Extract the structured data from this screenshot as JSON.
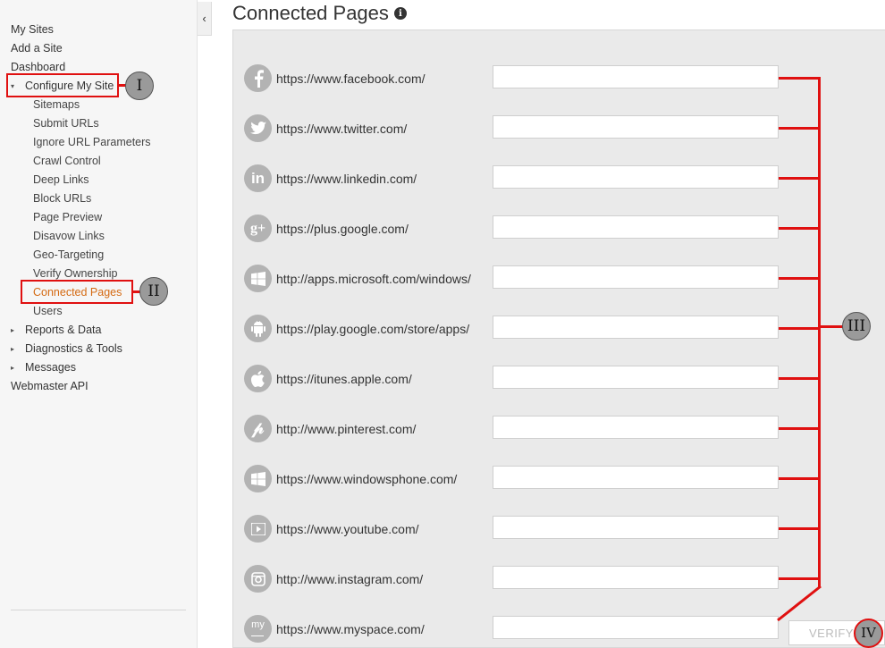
{
  "sidebar": {
    "items": [
      {
        "label": "My Sites"
      },
      {
        "label": "Add a Site"
      },
      {
        "label": "Dashboard"
      },
      {
        "label": "Configure My Site"
      },
      {
        "label": "Sitemaps"
      },
      {
        "label": "Submit URLs"
      },
      {
        "label": "Ignore URL Parameters"
      },
      {
        "label": "Crawl Control"
      },
      {
        "label": "Deep Links"
      },
      {
        "label": "Block URLs"
      },
      {
        "label": "Page Preview"
      },
      {
        "label": "Disavow Links"
      },
      {
        "label": "Geo-Targeting"
      },
      {
        "label": "Verify Ownership"
      },
      {
        "label": "Connected Pages"
      },
      {
        "label": "Users"
      },
      {
        "label": "Reports & Data"
      },
      {
        "label": "Diagnostics & Tools"
      },
      {
        "label": "Messages"
      },
      {
        "label": "Webmaster API"
      }
    ],
    "expanded_marker": "▾",
    "collapsed_marker": "▸"
  },
  "annotations": {
    "one": "I",
    "two": "II",
    "three": "III",
    "four": "IV"
  },
  "collapse_glyph": "‹",
  "main": {
    "title": "Connected Pages",
    "info_glyph": "i",
    "sites": [
      {
        "icon": "facebook-icon",
        "url": "https://www.facebook.com/",
        "value": ""
      },
      {
        "icon": "twitter-icon",
        "url": "https://www.twitter.com/",
        "value": ""
      },
      {
        "icon": "linkedin-icon",
        "url": "https://www.linkedin.com/",
        "value": ""
      },
      {
        "icon": "google-plus-icon",
        "url": "https://plus.google.com/",
        "value": ""
      },
      {
        "icon": "windows-icon",
        "url": "http://apps.microsoft.com/windows/",
        "value": ""
      },
      {
        "icon": "android-icon",
        "url": "https://play.google.com/store/apps/",
        "value": ""
      },
      {
        "icon": "apple-icon",
        "url": "https://itunes.apple.com/",
        "value": ""
      },
      {
        "icon": "pinterest-icon",
        "url": "http://www.pinterest.com/",
        "value": ""
      },
      {
        "icon": "windows-phone-icon",
        "url": "https://www.windowsphone.com/",
        "value": ""
      },
      {
        "icon": "youtube-icon",
        "url": "https://www.youtube.com/",
        "value": ""
      },
      {
        "icon": "instagram-icon",
        "url": "http://www.instagram.com/",
        "value": ""
      },
      {
        "icon": "myspace-icon",
        "url": "https://www.myspace.com/",
        "value": ""
      }
    ],
    "verify_label": "VERIFY"
  },
  "colors": {
    "accent": "#d46a13",
    "annotation": "#e01010",
    "icon_bg": "#b3b3b3"
  }
}
